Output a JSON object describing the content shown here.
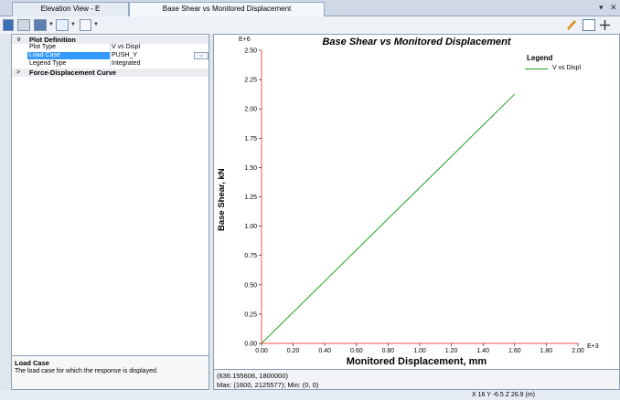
{
  "tabs": [
    {
      "label": "Elevation View - E"
    },
    {
      "label": "Base Shear vs Monitored Displacement"
    }
  ],
  "window_controls": {
    "dropdown": "▾",
    "close": "✕"
  },
  "toolbar": {
    "buttons": [
      "save-icon",
      "print-icon",
      "export-icon",
      "table-icon",
      "chart-options-icon"
    ],
    "right_buttons": [
      "pencil-icon",
      "display-icon",
      "pan-icon"
    ]
  },
  "properties": {
    "plot_definition": {
      "title": "Plot Definition",
      "rows": [
        {
          "key": "Plot Type",
          "value": "V vs Displ"
        },
        {
          "key": "Load Case",
          "value": "PUSH_Y"
        },
        {
          "key": "Legend Type",
          "value": "Integrated"
        }
      ]
    },
    "force_disp": {
      "title": "Force-Displacement Curve"
    },
    "description": {
      "title": "Load Case",
      "text": "The load case for which the response is displayed."
    }
  },
  "chart_data": {
    "type": "line",
    "title": "Base Shear vs Monitored Displacement",
    "xlabel": "Monitored Displacement, mm",
    "ylabel": "Base Shear, kN",
    "x_exponent": "E+3",
    "y_exponent": "E+6",
    "xlim": [
      0,
      2.0
    ],
    "ylim": [
      0,
      2.5
    ],
    "x_ticks": [
      "0.00",
      "0.20",
      "0.40",
      "0.60",
      "0.80",
      "1.00",
      "1.20",
      "1.40",
      "1.60",
      "1.80",
      "2.00"
    ],
    "y_ticks": [
      "0.00",
      "0.25",
      "0.50",
      "0.75",
      "1.00",
      "1.25",
      "1.50",
      "1.75",
      "2.00",
      "2.25",
      "2.50"
    ],
    "series": [
      {
        "name": "V vs Displ",
        "color": "#22a322",
        "x": [
          0.0,
          1.6
        ],
        "y": [
          0.0,
          2.125577
        ]
      }
    ],
    "legend": {
      "title": "Legend",
      "placement": "top-right"
    },
    "axis_color": "#ff4d4d",
    "grid": false
  },
  "status": {
    "cursor": "(636.155606, 1800000)",
    "maxmin": "Max: (1600, 2125577);  Min: (0, 0)"
  },
  "coords": "X 16  Y -6.5  Z 26.9 (m)"
}
